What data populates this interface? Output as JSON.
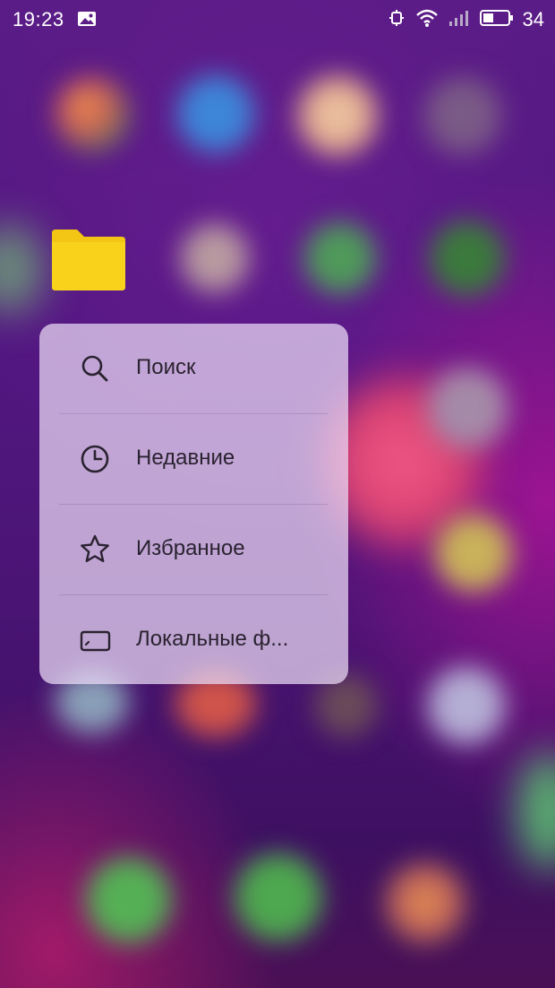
{
  "status_bar": {
    "time": "19:23",
    "battery_level": "34",
    "icons": [
      "gallery-icon",
      "sync-icon",
      "wifi-icon",
      "signal-icon",
      "battery-icon"
    ]
  },
  "home": {
    "folder_icon": "folder-icon",
    "folder_color": "#f6cc12"
  },
  "context_menu": {
    "items": [
      {
        "label": "Поиск",
        "icon": "search-icon"
      },
      {
        "label": "Недавние",
        "icon": "clock-icon"
      },
      {
        "label": "Избранное",
        "icon": "star-icon"
      },
      {
        "label": "Локальные ф...",
        "icon": "storage-icon"
      }
    ]
  },
  "colors": {
    "wallpaper": "#4b1475",
    "menu_background": "#ecdcf6",
    "menu_text": "#2a2230"
  }
}
